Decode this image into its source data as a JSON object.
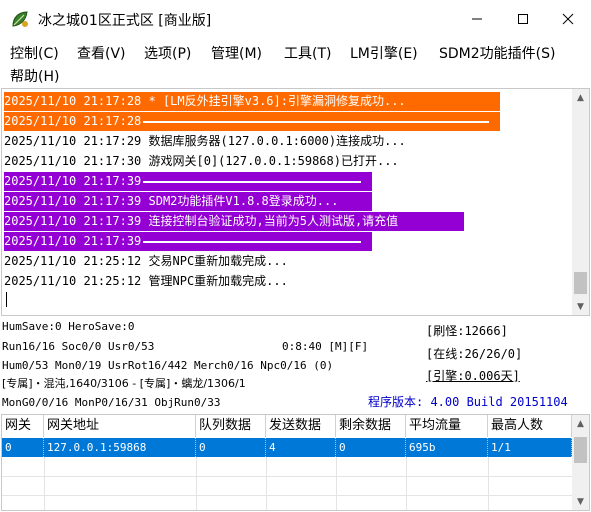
{
  "window": {
    "title": "冰之城01区正式区 [商业版]",
    "icon": "leaf-app-icon",
    "controls": {
      "minimize": "minimize-icon",
      "maximize": "maximize-icon",
      "close": "close-icon"
    }
  },
  "menu": {
    "items": [
      "控制(C)",
      "查看(V)",
      "选项(P)",
      "管理(M)",
      "工具(T)",
      "LM引擎(E)",
      "SDM2功能插件(S)",
      "帮助(H)"
    ]
  },
  "log": {
    "lines": [
      {
        "text": "2025/11/10 21:17:28 * [LM反外挂引擎v3.6]:引擎漏洞修复成功...",
        "style": "orange"
      },
      {
        "text": "2025/11/10 21:17:28",
        "style": "orange",
        "dash": true
      },
      {
        "text": "2025/11/10 21:17:29 数据库服务器(127.0.0.1:6000)连接成功...",
        "style": "normal"
      },
      {
        "text": "2025/11/10 21:17:30 游戏网关[0](127.0.0.1:59868)已打开...",
        "style": "normal"
      },
      {
        "text": "2025/11/10 21:17:39",
        "style": "purple",
        "dash": true
      },
      {
        "text": "2025/11/10 21:17:39 SDM2功能插件V1.8.8登录成功...",
        "style": "purple"
      },
      {
        "text": "2025/11/10 21:17:39 连接控制台验证成功,当前为5人测试版,请充值",
        "style": "purple"
      },
      {
        "text": "2025/11/10 21:17:39",
        "style": "purple",
        "dash": true
      },
      {
        "text": "2025/11/10 21:25:12 交易NPC重新加载完成...",
        "style": "normal"
      },
      {
        "text": "2025/11/10 21:25:12 管理NPC重新加载完成...",
        "style": "normal"
      }
    ]
  },
  "status": {
    "line1": "HumSave:0 HeroSave:0",
    "line2": "Run16/16 Soc0/0 Usr0/53",
    "time": "0:8:40 [M][F]",
    "line3": "Hum0/53 Mon0/19 UsrRot16/442 Merch0/16 Npc0/16 (0)",
    "line4": "[专属]・混沌,1640/3106 - [专属]・螭龙/1306/1",
    "line5": "MonG0/0/16 MonP0/16/31 ObjRun0/33",
    "refresh": "[刷怪:12666]",
    "online": "[在线:26/26/0]",
    "engine": "[引擎:0.006天]",
    "version": "程序版本: 4.00 Build 20151104",
    "colors": {
      "version": "#0000cc"
    }
  },
  "table": {
    "headers": [
      "网关",
      "网关地址",
      "队列数据",
      "发送数据",
      "剩余数据",
      "平均流量",
      "最高人数"
    ],
    "rows": [
      [
        "0",
        "127.0.0.1:59868",
        "0",
        "4",
        "0",
        "695b",
        "1/1"
      ]
    ],
    "selection_color": "#0078d7"
  },
  "colors": {
    "orange": "#ff6a00",
    "purple": "#9400d3"
  }
}
